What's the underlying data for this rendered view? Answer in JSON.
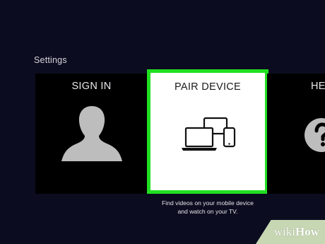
{
  "settings": {
    "title": "Settings"
  },
  "tiles": [
    {
      "label": "SIGN IN",
      "icon": "person-silhouette-icon"
    },
    {
      "label": "PAIR DEVICE",
      "icon": "devices-icon",
      "selected": true,
      "description_line1": "Find videos on your mobile device",
      "description_line2": "and watch on your TV."
    },
    {
      "label": "HE",
      "icon": "help-question-icon"
    }
  ],
  "watermark": {
    "prefix": "wiki",
    "suffix": "How"
  },
  "colors": {
    "background": "#0b0c1f",
    "selection": "#21e021",
    "tile": "#000000",
    "selected_tile": "#ffffff"
  }
}
